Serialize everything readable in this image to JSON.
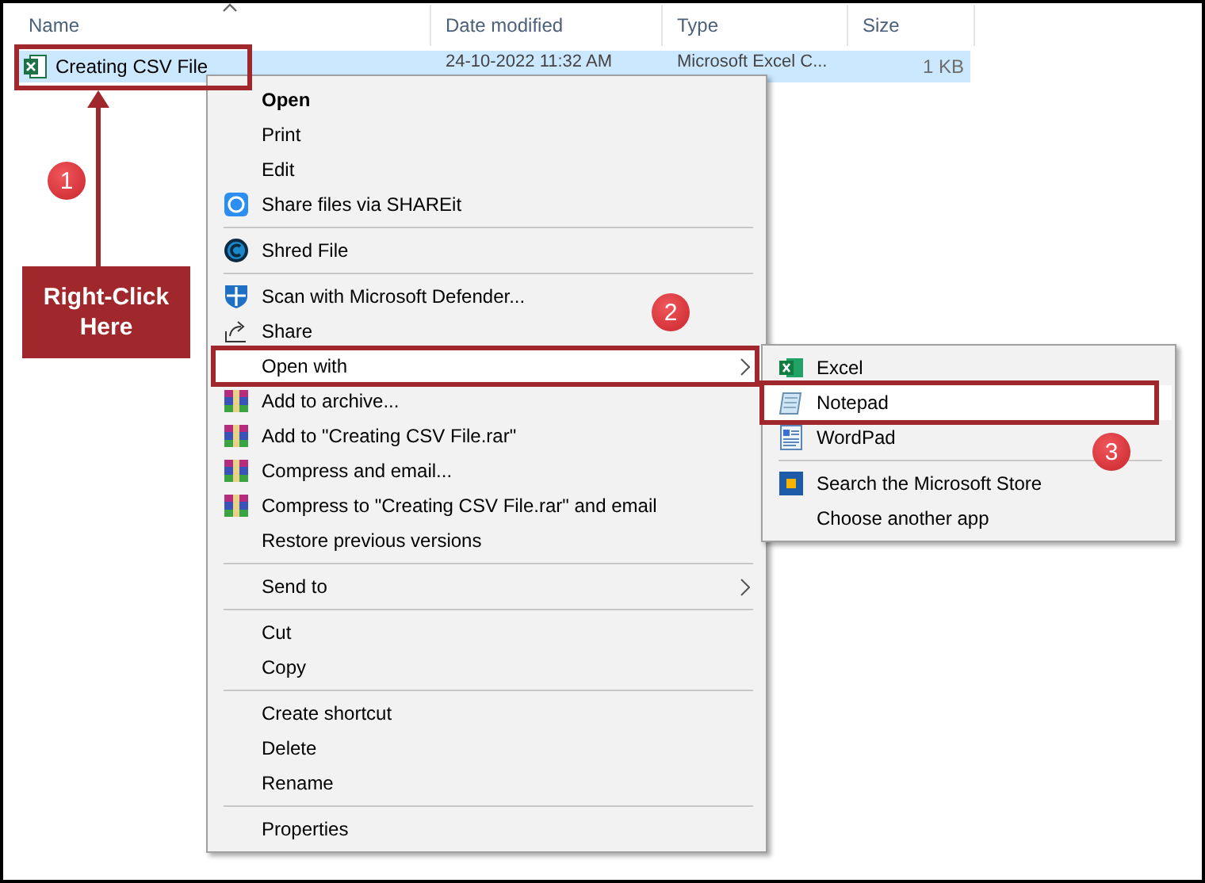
{
  "columns": [
    {
      "label": "Name",
      "sorted": true
    },
    {
      "label": "Date modified",
      "sorted": false
    },
    {
      "label": "Type",
      "sorted": false
    },
    {
      "label": "Size",
      "sorted": false
    }
  ],
  "file": {
    "name": "Creating CSV File",
    "date": "24-10-2022 11:32 AM",
    "type": "Microsoft Excel C...",
    "size": "1 KB",
    "selected": true
  },
  "context_menu": [
    {
      "kind": "default",
      "label": "Open"
    },
    {
      "kind": "plain",
      "label": "Print"
    },
    {
      "kind": "plain",
      "label": "Edit"
    },
    {
      "kind": "shareit",
      "label": "Share files via SHAREit"
    },
    {
      "kind": "separator"
    },
    {
      "kind": "shred",
      "label": "Shred File"
    },
    {
      "kind": "separator"
    },
    {
      "kind": "defender",
      "label": "Scan with Microsoft Defender..."
    },
    {
      "kind": "share",
      "label": "Share"
    },
    {
      "kind": "submenu",
      "label": "Open with",
      "selected": true
    },
    {
      "kind": "archive",
      "label": "Add to archive..."
    },
    {
      "kind": "archive",
      "label": "Add to \"Creating CSV File.rar\""
    },
    {
      "kind": "archive",
      "label": "Compress and email..."
    },
    {
      "kind": "archive",
      "label": "Compress to \"Creating CSV File.rar\" and email"
    },
    {
      "kind": "plain",
      "label": "Restore previous versions"
    },
    {
      "kind": "separator"
    },
    {
      "kind": "submenu",
      "label": "Send to",
      "selected": false
    },
    {
      "kind": "separator"
    },
    {
      "kind": "plain",
      "label": "Cut"
    },
    {
      "kind": "plain",
      "label": "Copy"
    },
    {
      "kind": "separator"
    },
    {
      "kind": "plain",
      "label": "Create shortcut"
    },
    {
      "kind": "plain",
      "label": "Delete"
    },
    {
      "kind": "plain",
      "label": "Rename"
    },
    {
      "kind": "separator"
    },
    {
      "kind": "plain",
      "label": "Properties"
    }
  ],
  "open_with_menu": [
    {
      "kind": "excel",
      "label": "Excel",
      "selected": false
    },
    {
      "kind": "notepad",
      "label": "Notepad",
      "selected": true
    },
    {
      "kind": "wordpad",
      "label": "WordPad",
      "selected": false
    },
    {
      "kind": "separator"
    },
    {
      "kind": "store",
      "label": "Search the Microsoft Store",
      "selected": false
    },
    {
      "kind": "plain",
      "label": "Choose another app",
      "selected": false
    }
  ],
  "annotations": {
    "steps": [
      "1",
      "2",
      "3"
    ],
    "callout": "Right-Click Here"
  }
}
